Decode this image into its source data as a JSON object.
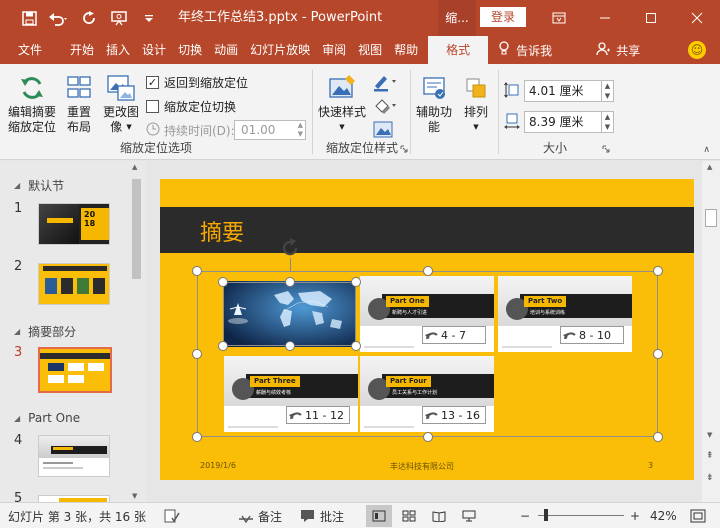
{
  "titlebar": {
    "doc_title": "年终工作总结3.pptx - PowerPoint",
    "context_tab": "缩...",
    "login": "登录",
    "qat_icons": [
      "save-icon",
      "undo-icon",
      "redo-icon",
      "present-icon",
      "customize-icon"
    ],
    "window_icons": [
      "ribbon-display-icon",
      "minimize-icon",
      "maximize-icon",
      "close-icon"
    ]
  },
  "tabs": [
    "文件",
    "开始",
    "插入",
    "设计",
    "切换",
    "动画",
    "幻灯片放映",
    "审阅",
    "视图",
    "帮助"
  ],
  "active_tab": "格式",
  "tell_me": "告诉我",
  "share": "共享",
  "ribbon": {
    "group1": {
      "label": "缩放定位选项",
      "edit_summary": [
        "编辑摘要",
        "缩放定位"
      ],
      "reset_layout": [
        "重置",
        "布局"
      ],
      "change_image": [
        "更改图",
        "像"
      ],
      "return_to_zoom": "返回到缩放定位",
      "return_checked": true,
      "zoom_transition": "缩放定位切换",
      "transition_checked": false,
      "duration_label": "持续时间(D):",
      "duration_value": "01.00"
    },
    "group2": {
      "label": "缩放定位样式",
      "quick_styles": "快速样式"
    },
    "group3": {
      "accessibility": [
        "辅助功",
        "能"
      ],
      "arrange": "排列"
    },
    "group4": {
      "label": "大小",
      "height": "4.01 厘米",
      "width": "8.39 厘米"
    }
  },
  "thumbs": {
    "sections": [
      "默认节",
      "摘要部分",
      "Part One"
    ],
    "slides": [
      "1",
      "2",
      "3",
      "4",
      "5"
    ],
    "active_slide": "3"
  },
  "slide": {
    "title": "摘要",
    "cards": [
      {
        "title": "Part One",
        "subtitle": "新聘与人才引进",
        "range": "4 - 7"
      },
      {
        "title": "Part Two",
        "subtitle": "培训与系统训练",
        "range": "8 - 10"
      },
      {
        "title": "Part Three",
        "subtitle": "薪酬与绩效考核",
        "range": "11 - 12"
      },
      {
        "title": "Part Four",
        "subtitle": "员工关系与工作计划",
        "range": "13 - 16"
      }
    ],
    "footer_date": "2019/1/6",
    "footer_company": "丰达科技有限公司",
    "footer_page": "3"
  },
  "status": {
    "slide_info": "幻灯片 第 3 张，共 16 张",
    "notes": "备注",
    "comments": "批注",
    "zoom": "42%"
  },
  "colors": {
    "brand": "#b7472a",
    "slide_bg": "#fbbe08",
    "band": "#2b2b2b",
    "title": "#f7a900"
  }
}
